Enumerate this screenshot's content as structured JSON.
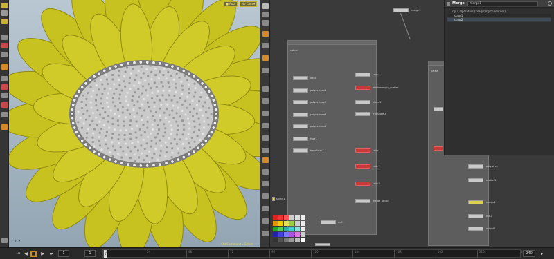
{
  "viewport": {
    "chip_left": "■ Auto",
    "chip_right": "No Cam ▾",
    "footer": "Ctrl/Command ▸ Select",
    "axis": "Y\nx ↗",
    "colors": {
      "petal": "#c7c21f",
      "petal_dark": "#8f8a14",
      "seed": "#c9c9c9",
      "seed_dark": "#7d7d7d",
      "sky_top": "#b9c7d2"
    }
  },
  "network": {
    "top_node_label": "merge1",
    "box1": {
      "title": "subnet",
      "left_nodes": [
        "add1",
        "polyextrude1",
        "polyextrude2",
        "polyextrude3",
        "polyextrude4",
        "fuse1",
        "transform1"
      ],
      "right_nodes": [
        "copy1",
        "attribwrangle_scatter",
        "xform1",
        "transform2",
        "color1",
        "color2",
        "color3",
        "merge_petals"
      ],
      "bottom_node": "null1",
      "note": "sticky1"
    },
    "box2": {
      "title": "petals",
      "right_nodes": [
        "polywire1",
        "scatter1",
        "merge2",
        "null2",
        "output1"
      ]
    }
  },
  "parameters": {
    "node_type": "Merge",
    "node_name": "merge1",
    "section_label": "Input Operators (Drag/Drop to reorder)",
    "inputs": [
      "color1",
      "color2"
    ]
  },
  "timeline": {
    "buttons": [
      "⏮",
      "◀",
      "■",
      "▶",
      "⏭"
    ],
    "start_frame": "1",
    "end_frame": "1",
    "current_frame": "1",
    "range_end": "240",
    "ticks": [
      "1",
      "24",
      "48",
      "72",
      "96",
      "120",
      "144",
      "168",
      "192",
      "216",
      "240"
    ]
  },
  "palette_colors": [
    "#d22",
    "#e33",
    "#f55",
    "#ccc",
    "#ddd",
    "#eee",
    "#d90",
    "#ec0",
    "#dd5",
    "#9c4",
    "#ccc",
    "#eee",
    "#2a2",
    "#5c5",
    "#3aa",
    "#4cc",
    "#8dd",
    "#eee",
    "#22a",
    "#44d",
    "#77f",
    "#a5d",
    "#d7d",
    "#ccc",
    "#333",
    "#555",
    "#777",
    "#999",
    "#bbb",
    "#fff"
  ]
}
